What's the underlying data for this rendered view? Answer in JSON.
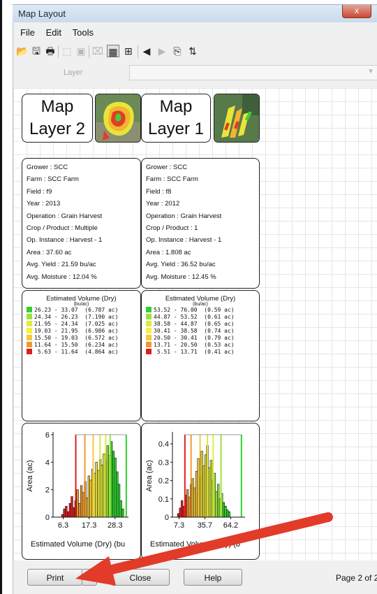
{
  "window": {
    "title": "Map Layout",
    "close_glyph": "x"
  },
  "menu": [
    "File",
    "Edit",
    "Tools"
  ],
  "toolbar_icons": [
    {
      "name": "open-folder-icon",
      "glyph": "📂",
      "state": "normal"
    },
    {
      "name": "save-icon",
      "glyph": "🖫",
      "state": "normal"
    },
    {
      "name": "print-preview-icon",
      "glyph": "🖶",
      "state": "normal"
    },
    {
      "name": "select-tool-icon",
      "glyph": "⬚",
      "state": "disabled"
    },
    {
      "name": "properties-icon",
      "glyph": "▣",
      "state": "disabled"
    },
    {
      "name": "delete-icon",
      "glyph": "⌧",
      "state": "disabled"
    },
    {
      "name": "grid-toggle-icon",
      "glyph": "▦",
      "state": "pressed"
    },
    {
      "name": "snap-grid-icon",
      "glyph": "⊞",
      "state": "normal"
    },
    {
      "name": "previous-page-icon",
      "glyph": "◀",
      "state": "normal"
    },
    {
      "name": "next-page-icon",
      "glyph": "▶",
      "state": "disabled"
    },
    {
      "name": "page-setup-icon",
      "glyph": "⎘",
      "state": "normal"
    },
    {
      "name": "sort-icon",
      "glyph": "⇅",
      "state": "normal"
    }
  ],
  "layer": {
    "label": "Layer",
    "value": ""
  },
  "panels": [
    {
      "title": "Map\nLayer 2",
      "info": [
        "Grower : SCC",
        "Farm  : SCC Farm",
        "Field  : f9",
        "Year : 2013",
        "Operation  : Grain Harvest",
        "Crop / Product : Multiple",
        "Op. Instance : Harvest - 1",
        "Area : 37.60 ac",
        "Avg. Yield : 21.59 bu/ac",
        "Avg. Moisture : 12.04 %"
      ],
      "legend_title": "Estimated Volume (Dry)",
      "legend_unit": "(bu/ac)",
      "legend": [
        {
          "text": "26.23 - 33.07  (6.787 ac)",
          "color": "#2fd12f"
        },
        {
          "text": "24.34 - 26.23  (7.190 ac)",
          "color": "#9be33a"
        },
        {
          "text": "21.95 - 24.34  (7.025 ac)",
          "color": "#d9ef3d"
        },
        {
          "text": "19.03 - 21.95  (6.986 ac)",
          "color": "#f6f03c"
        },
        {
          "text": "15.50 - 19.03  (6.572 ac)",
          "color": "#f4c93a"
        },
        {
          "text": "11.64 - 15.50  (6.234 ac)",
          "color": "#ee9a2e"
        },
        {
          "text": " 5.63 - 11.64  (4.864 ac)",
          "color": "#e01e1e"
        }
      ],
      "histogram": {
        "y_ticks": [
          "0",
          "2",
          "4",
          "6"
        ],
        "x_ticks": [
          "6.3",
          "17.3",
          "28.3"
        ],
        "ylabel": "Area (ac)",
        "xlabel": "Estimated Volume (Dry) (bu",
        "xlim": [
          2,
          34
        ],
        "ylim": [
          0,
          6
        ],
        "bin_width": 0.8,
        "values": [
          0.2,
          0.6,
          0.8,
          0.4,
          1.0,
          1.5,
          0.7,
          1.2,
          2.0,
          1.0,
          2.3,
          1.8,
          2.6,
          1.4,
          3.0,
          2.7,
          3.5,
          3.2,
          4.0,
          3.4,
          4.2,
          3.8,
          4.6,
          4.1,
          5.2,
          4.5,
          5.5,
          4.8,
          4.3,
          3.3,
          2.4,
          1.2,
          0.6
        ],
        "bins_start": 5.6,
        "breaks": [
          {
            "x": 11.64,
            "color": "#e01e1e"
          },
          {
            "x": 15.5,
            "color": "#ee9a2e"
          },
          {
            "x": 19.03,
            "color": "#f4c93a"
          },
          {
            "x": 21.95,
            "color": "#e6e23a"
          },
          {
            "x": 24.34,
            "color": "#d9ef3d"
          },
          {
            "x": 26.23,
            "color": "#9be33a"
          },
          {
            "x": 33.07,
            "color": "#2fd12f"
          }
        ]
      }
    },
    {
      "title": "Map\nLayer 1",
      "info": [
        "Grower : SCC",
        "Farm  : SCC Farm",
        "Field  : f8",
        "Year : 2012",
        "Operation  : Grain Harvest",
        "Crop / Product : 1",
        "Op. Instance : Harvest - 1",
        "Area : 1.808 ac",
        "Avg. Yield : 36.52 bu/ac",
        "Avg. Moisture : 12.45 %"
      ],
      "legend_title": "Estimated Volume (Dry)",
      "legend_unit": "(bu/ac)",
      "legend": [
        {
          "text": "53.52 - 76.00  (0.59 ac)",
          "color": "#2fd12f"
        },
        {
          "text": "44.87 - 53.52  (0.61 ac)",
          "color": "#9be33a"
        },
        {
          "text": "38.58 - 44.87  (0.65 ac)",
          "color": "#d9ef3d"
        },
        {
          "text": "30.41 - 38.58  (0.74 ac)",
          "color": "#f6f03c"
        },
        {
          "text": "20.50 - 30.41  (0.79 ac)",
          "color": "#f4c93a"
        },
        {
          "text": "13.71 - 20.50  (0.53 ac)",
          "color": "#ee9a2e"
        },
        {
          "text": " 5.51 - 13.71  (0.41 ac)",
          "color": "#e01e1e"
        }
      ],
      "histogram": {
        "y_ticks": [
          "0",
          "0.1",
          "0.2",
          "0.3",
          "0.4"
        ],
        "x_ticks": [
          "7.3",
          "35.7",
          "64.2"
        ],
        "ylabel": "Area (ac)",
        "xlabel": "Estimated Volume (Dry) (b",
        "xlim": [
          0,
          80
        ],
        "ylim": [
          0,
          0.45
        ],
        "bin_width": 2.0,
        "values": [
          0.02,
          0.05,
          0.09,
          0.06,
          0.12,
          0.15,
          0.11,
          0.18,
          0.21,
          0.16,
          0.25,
          0.32,
          0.22,
          0.36,
          0.28,
          0.34,
          0.39,
          0.27,
          0.31,
          0.2,
          0.24,
          0.14,
          0.18,
          0.1,
          0.13,
          0.08,
          0.06,
          0.04,
          0.03
        ],
        "bins_start": 5.5,
        "breaks": [
          {
            "x": 13.71,
            "color": "#e01e1e"
          },
          {
            "x": 20.5,
            "color": "#ee9a2e"
          },
          {
            "x": 30.41,
            "color": "#f4c93a"
          },
          {
            "x": 38.58,
            "color": "#e6e23a"
          },
          {
            "x": 44.87,
            "color": "#d9ef3d"
          },
          {
            "x": 53.52,
            "color": "#9be33a"
          },
          {
            "x": 76.0,
            "color": "#2fd12f"
          }
        ]
      }
    }
  ],
  "buttons": {
    "print": "Print",
    "print_dropdown": "▾",
    "close": "Close",
    "help": "Help"
  },
  "page_status": "Page 2 of 2",
  "colors": {
    "annotation_arrow": "#e23b2a"
  }
}
